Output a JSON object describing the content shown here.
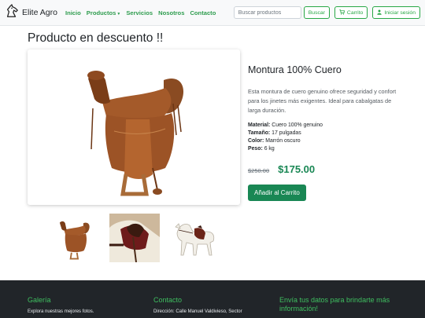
{
  "navbar": {
    "brand": "Elite Agro",
    "links": [
      "Inicio",
      "Productos",
      "Servicios",
      "Nosotros",
      "Contacto"
    ],
    "search_placeholder": "Buscar productos",
    "search_button": "Buscar",
    "cart_button": "Carrito",
    "login_button": "Iniciar sesión"
  },
  "main": {
    "page_title": "Producto en descuento !!",
    "product": {
      "name": "Montura 100% Cuero",
      "description": "Esta montura de cuero genuino ofrece seguridad y confort para los jinetes más exigentes. Ideal para cabalgatas de larga duración.",
      "specs": [
        {
          "label": "Material:",
          "value": "Cuero 100% genuino"
        },
        {
          "label": "Tamaño:",
          "value": "17 pulgadas"
        },
        {
          "label": "Color:",
          "value": "Marrón oscuro"
        },
        {
          "label": "Peso:",
          "value": "6 kg"
        }
      ],
      "old_price": "$250.00",
      "new_price": "$175.00",
      "add_to_cart": "Añadir al Carrito"
    }
  },
  "footer": {
    "gallery_heading": "Galería",
    "gallery_text": "Explora nuestras mejores fotos.",
    "contact_heading": "Contacto",
    "contact_text": "Dirección: Calle Manuel Valdivieso, Sector",
    "newsletter_heading": "Envía tus datos para brindarte más información!"
  },
  "colors": {
    "accent": "#198754",
    "nav_link": "#2e9c4e",
    "footer_bg": "#212529"
  }
}
